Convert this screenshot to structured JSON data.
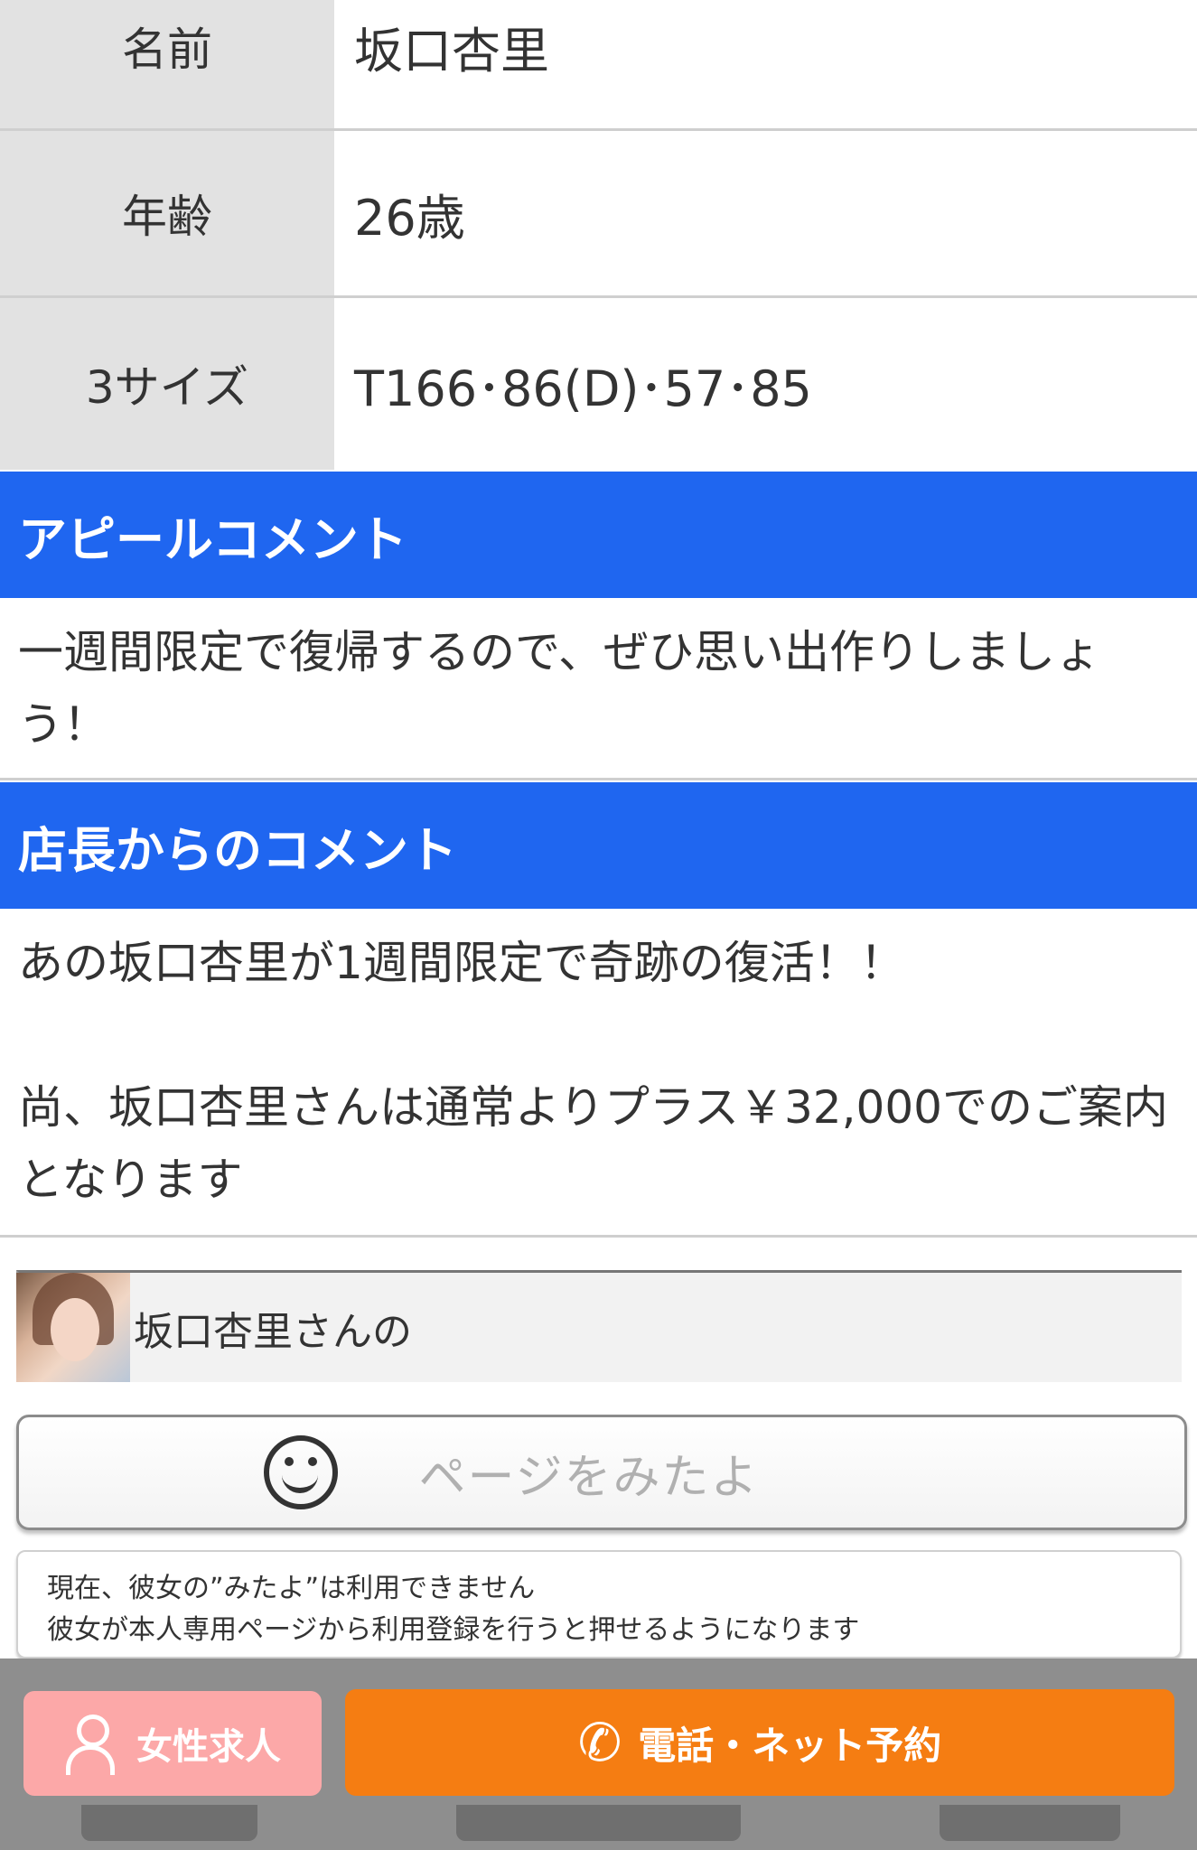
{
  "profile": {
    "rows": [
      {
        "label": "名前",
        "value": "坂口杏里"
      },
      {
        "label": "年齢",
        "value": "26歳"
      },
      {
        "label": "3サイズ",
        "value": "T166･86(D)･57･85"
      }
    ]
  },
  "appeal": {
    "title": "アピールコメント",
    "text": "一週間限定で復帰するので、ぜひ思い出作りしましょう！"
  },
  "manager": {
    "title": "店長からのコメント",
    "line1": "あの坂口杏里が1週間限定で奇跡の復活！！",
    "line2": "尚、坂口杏里さんは通常よりプラス￥32,000でのご案内となります"
  },
  "mitayo": {
    "title": "坂口杏里さんの",
    "button_label": "ページをみたよ",
    "notice_line1": "現在、彼女の”みたよ”は利用できません",
    "notice_line2": "彼女が本人専用ページから利用登録を行うと押せるようになります"
  },
  "bottom_bar": {
    "recruit_label": "女性求人",
    "reserve_label": "電話・ネット予約"
  },
  "colors": {
    "section_header": "#1f66f0",
    "recruit_button": "#fca8a8",
    "reserve_button": "#f57d12"
  }
}
